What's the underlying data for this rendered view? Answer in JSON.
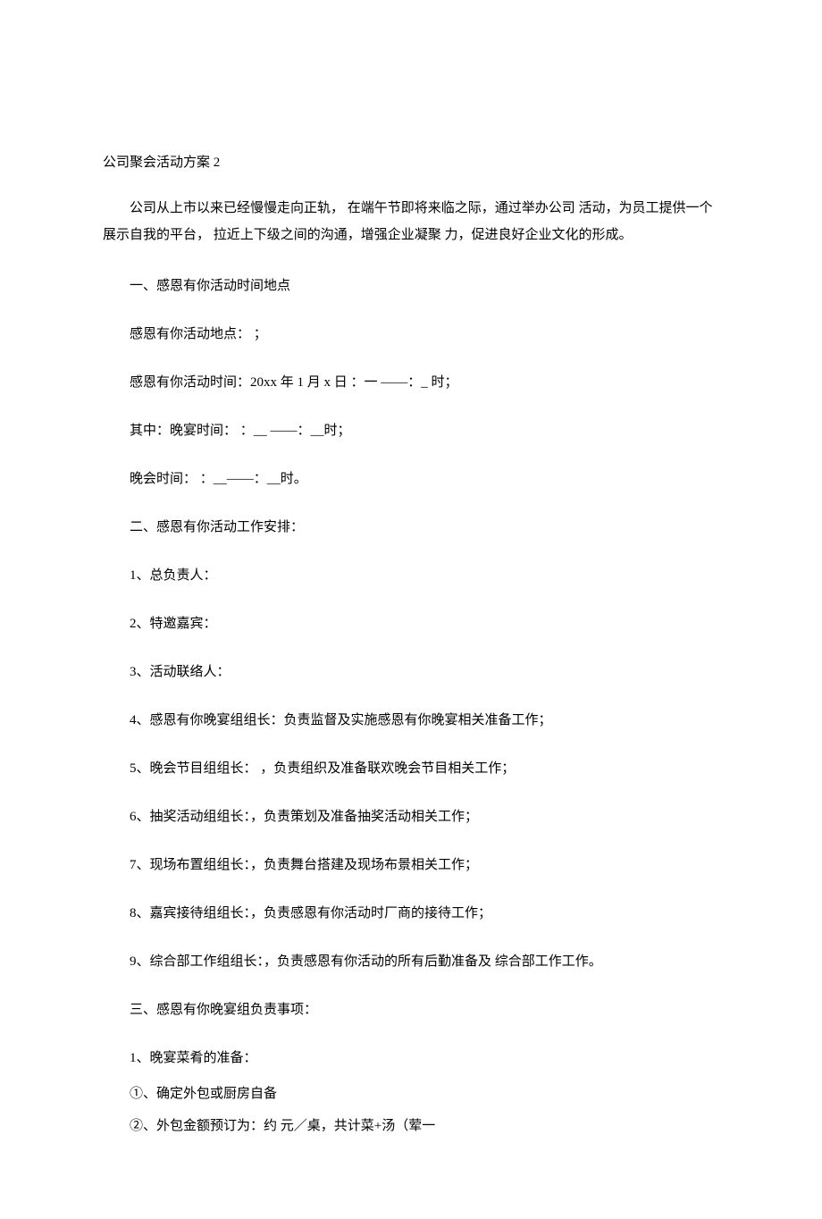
{
  "title": "公司聚会活动方案 2",
  "intro": "公司从上市以来已经慢慢走向正轨， 在端午节即将来临之际，通过举办公司 活动，为员工提供一个展示自我的平台， 拉近上下级之间的沟通，增强企业凝聚 力，促进良好企业文化的形成。",
  "s1": {
    "head": "一、感恩有你活动时间地点",
    "p1": "感恩有你活动地点： ；",
    "p2": "感恩有你活动时间：20xx 年 1 月 x 日 ：一 ——：_ 时；",
    "p3": "其中：晚宴时间： ：__ ——：__时；",
    "p4": "晚会时间： ：__——：__时。"
  },
  "s2": {
    "head": "二、感恩有你活动工作安排：",
    "i1": "1、总负责人：",
    "i2": "2、特邀嘉宾：",
    "i3": "3、活动联络人：",
    "i4": "4、感恩有你晚宴组组长：负责监督及实施感恩有你晚宴相关准备工作；",
    "i5": "5、晚会节目组组长： ，负责组织及准备联欢晚会节目相关工作；",
    "i6": "6、抽奖活动组组长：，负责策划及准备抽奖活动相关工作；",
    "i7": "7、现场布置组组长：，负责舞台搭建及现场布景相关工作；",
    "i8": "8、嘉宾接待组组长：，负责感恩有你活动时厂商的接待工作；",
    "i9": "9、综合部工作组组长：，负责感恩有你活动的所有后勤准备及 综合部工作工作。"
  },
  "s3": {
    "head": "三、感恩有你晚宴组负责事项：",
    "i1": "1、晚宴菜肴的准备：",
    "i1a": "①、确定外包或厨房自备",
    "i1b": "②、外包金额预订为：约 元／桌，共计菜+汤（荤一"
  }
}
